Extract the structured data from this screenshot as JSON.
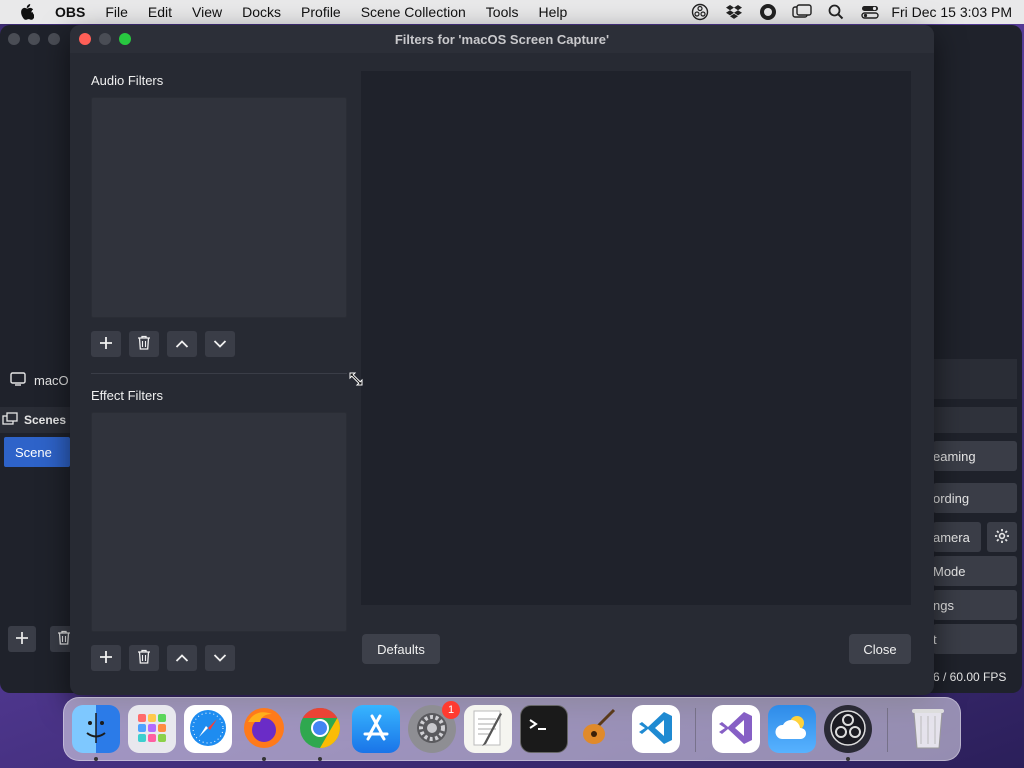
{
  "menubar": {
    "app_name": "OBS",
    "items": [
      "File",
      "Edit",
      "View",
      "Docks",
      "Profile",
      "Scene Collection",
      "Tools",
      "Help"
    ],
    "clock": "Fri Dec 15  3:03 PM"
  },
  "main_window": {
    "source_label": "macO",
    "scenes_header": "Scenes",
    "scene_item": "Scene",
    "controls": [
      "eaming",
      "ording",
      "amera",
      "Mode",
      "ngs",
      "t"
    ],
    "fps": "6 / 60.00 FPS"
  },
  "dialog": {
    "title": "Filters for 'macOS Screen Capture'",
    "audio_filters_label": "Audio Filters",
    "effect_filters_label": "Effect Filters",
    "defaults_label": "Defaults",
    "close_label": "Close"
  },
  "dock": {
    "apps": [
      "Finder",
      "Launchpad",
      "Safari",
      "Firefox",
      "Chrome",
      "App Store",
      "System Settings",
      "TextEdit",
      "Terminal",
      "GarageBand",
      "VS Code",
      "Visual Studio",
      "Weather",
      "OBS",
      "Trash"
    ],
    "settings_badge": "1"
  },
  "colors": {
    "accent": "#2e63c9",
    "dialog_bg": "#272a33",
    "preview_bg": "#1f222b"
  }
}
